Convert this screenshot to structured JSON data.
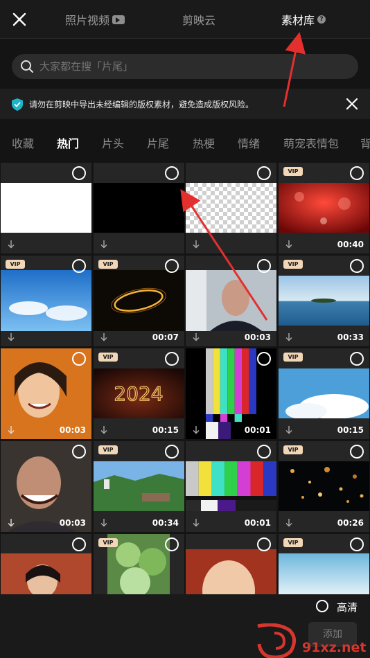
{
  "header": {
    "tabs": [
      {
        "label": "照片视频"
      },
      {
        "label": "剪映云"
      },
      {
        "label": "素材库",
        "active": true
      }
    ]
  },
  "search": {
    "placeholder": "大家都在搜「片尾」"
  },
  "notice": {
    "text": "请勿在剪映中导出未经编辑的版权素材，避免造成版权风险。"
  },
  "categories": [
    "收藏",
    "热门",
    "片头",
    "片尾",
    "热梗",
    "情绪",
    "萌宠表情包",
    "背"
  ],
  "active_category": "热门",
  "vip_label": "VIP",
  "items": [
    {
      "vip": false,
      "duration": "",
      "thumb": "white"
    },
    {
      "vip": false,
      "duration": "",
      "thumb": "black"
    },
    {
      "vip": false,
      "duration": "",
      "thumb": "transparent"
    },
    {
      "vip": true,
      "duration": "00:40",
      "thumb": "red-sparkle"
    },
    {
      "vip": true,
      "duration": "",
      "thumb": "blue-sky"
    },
    {
      "vip": true,
      "duration": "00:07",
      "thumb": "golden-ring"
    },
    {
      "vip": false,
      "duration": "00:03",
      "thumb": "man-face"
    },
    {
      "vip": true,
      "duration": "00:33",
      "thumb": "ocean-island"
    },
    {
      "vip": false,
      "duration": "00:03",
      "thumb": "girl-laugh"
    },
    {
      "vip": true,
      "duration": "00:15",
      "thumb": "2024-text"
    },
    {
      "vip": false,
      "duration": "00:01",
      "thumb": "color-bars-narrow"
    },
    {
      "vip": true,
      "duration": "00:15",
      "thumb": "clouds"
    },
    {
      "vip": false,
      "duration": "00:03",
      "thumb": "man-laugh"
    },
    {
      "vip": true,
      "duration": "00:34",
      "thumb": "city-landscape"
    },
    {
      "vip": false,
      "duration": "00:01",
      "thumb": "color-bars"
    },
    {
      "vip": true,
      "duration": "00:26",
      "thumb": "gold-particles"
    },
    {
      "vip": false,
      "duration": "",
      "thumb": "kid-room"
    },
    {
      "vip": true,
      "duration": "",
      "thumb": "forest"
    },
    {
      "vip": false,
      "duration": "",
      "thumb": "baby-laugh"
    },
    {
      "vip": true,
      "duration": "",
      "thumb": "sky-light"
    }
  ],
  "footer": {
    "hd_label": "高清",
    "add_label": "添加"
  },
  "watermark": {
    "text": "91xz.net"
  },
  "colors": {
    "background": "#141414",
    "accent": "#1fb5c9",
    "vip_badge": "#f1d7b7",
    "annotation": "#e3302f"
  }
}
